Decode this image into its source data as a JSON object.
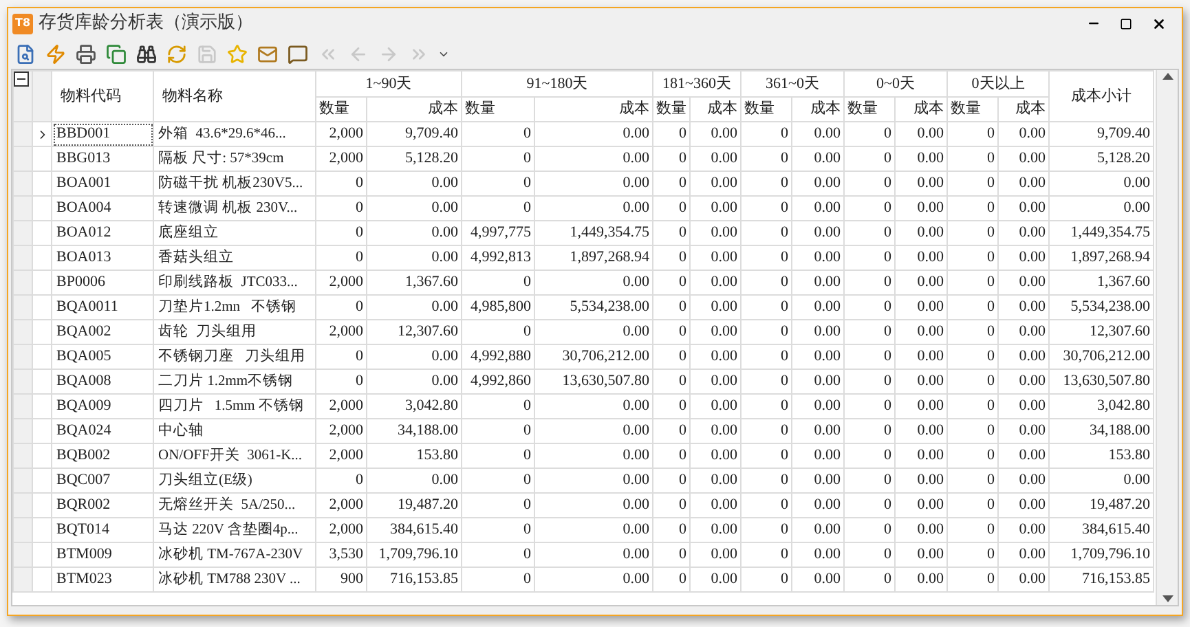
{
  "window": {
    "title": "存货库龄分析表（演示版）",
    "app_icon": "T8"
  },
  "toolbar": [
    {
      "kind": "preview",
      "disabled": false
    },
    {
      "kind": "flash",
      "disabled": false
    },
    {
      "kind": "print",
      "disabled": false
    },
    {
      "kind": "copy",
      "disabled": false
    },
    {
      "kind": "find",
      "disabled": false
    },
    {
      "kind": "refresh",
      "disabled": false
    },
    {
      "kind": "save",
      "disabled": true
    },
    {
      "kind": "star",
      "disabled": false
    },
    {
      "kind": "mail",
      "disabled": false
    },
    {
      "kind": "comment",
      "disabled": false
    },
    {
      "kind": "first",
      "disabled": true
    },
    {
      "kind": "prev",
      "disabled": true
    },
    {
      "kind": "next",
      "disabled": true
    },
    {
      "kind": "last",
      "disabled": true
    },
    {
      "kind": "more",
      "disabled": false
    }
  ],
  "table": {
    "columns": {
      "code": "物料代码",
      "name": "物料名称",
      "subtotal": "成本小计",
      "groups": [
        {
          "label": "1~90天",
          "qty": "数量",
          "cost": "成本"
        },
        {
          "label": "91~180天",
          "qty": "数量",
          "cost": "成本"
        },
        {
          "label": "181~360天",
          "qty": "数量",
          "cost": "成本"
        },
        {
          "label": "361~0天",
          "qty": "数量",
          "cost": "成本"
        },
        {
          "label": "0~0天",
          "qty": "数量",
          "cost": "成本"
        },
        {
          "label": "0天以上",
          "qty": "数量",
          "cost": "成本"
        }
      ]
    },
    "rows": [
      {
        "selected": true,
        "code": "BBD001",
        "name": "外箱  43.6*29.6*46...",
        "values": [
          "2,000",
          "9,709.40",
          "0",
          "0.00",
          "0",
          "0.00",
          "0",
          "0.00",
          "0",
          "0.00",
          "0",
          "0.00",
          "9,709.40"
        ]
      },
      {
        "selected": false,
        "code": "BBG013",
        "name": "隔板 尺寸: 57*39cm",
        "values": [
          "2,000",
          "5,128.20",
          "0",
          "0.00",
          "0",
          "0.00",
          "0",
          "0.00",
          "0",
          "0.00",
          "0",
          "0.00",
          "5,128.20"
        ]
      },
      {
        "selected": false,
        "code": "BOA001",
        "name": "防磁干扰 机板230V5...",
        "values": [
          "0",
          "0.00",
          "0",
          "0.00",
          "0",
          "0.00",
          "0",
          "0.00",
          "0",
          "0.00",
          "0",
          "0.00",
          "0.00"
        ]
      },
      {
        "selected": false,
        "code": "BOA004",
        "name": "转速微调 机板 230V...",
        "values": [
          "0",
          "0.00",
          "0",
          "0.00",
          "0",
          "0.00",
          "0",
          "0.00",
          "0",
          "0.00",
          "0",
          "0.00",
          "0.00"
        ]
      },
      {
        "selected": false,
        "code": "BOA012",
        "name": "底座组立",
        "values": [
          "0",
          "0.00",
          "4,997,775",
          "1,449,354.75",
          "0",
          "0.00",
          "0",
          "0.00",
          "0",
          "0.00",
          "0",
          "0.00",
          "1,449,354.75"
        ]
      },
      {
        "selected": false,
        "code": "BOA013",
        "name": "香菇头组立",
        "values": [
          "0",
          "0.00",
          "4,992,813",
          "1,897,268.94",
          "0",
          "0.00",
          "0",
          "0.00",
          "0",
          "0.00",
          "0",
          "0.00",
          "1,897,268.94"
        ]
      },
      {
        "selected": false,
        "code": "BP0006",
        "name": "印刷线路板  JTC033...",
        "values": [
          "2,000",
          "1,367.60",
          "0",
          "0.00",
          "0",
          "0.00",
          "0",
          "0.00",
          "0",
          "0.00",
          "0",
          "0.00",
          "1,367.60"
        ]
      },
      {
        "selected": false,
        "code": "BQA0011",
        "name": "刀垫片1.2mn   不锈钢",
        "values": [
          "0",
          "0.00",
          "4,985,800",
          "5,534,238.00",
          "0",
          "0.00",
          "0",
          "0.00",
          "0",
          "0.00",
          "0",
          "0.00",
          "5,534,238.00"
        ]
      },
      {
        "selected": false,
        "code": "BQA002",
        "name": "齿轮  刀头组用",
        "values": [
          "2,000",
          "12,307.60",
          "0",
          "0.00",
          "0",
          "0.00",
          "0",
          "0.00",
          "0",
          "0.00",
          "0",
          "0.00",
          "12,307.60"
        ]
      },
      {
        "selected": false,
        "code": "BQA005",
        "name": "不锈钢刀座   刀头组用",
        "values": [
          "0",
          "0.00",
          "4,992,880",
          "30,706,212.00",
          "0",
          "0.00",
          "0",
          "0.00",
          "0",
          "0.00",
          "0",
          "0.00",
          "30,706,212.00"
        ]
      },
      {
        "selected": false,
        "code": "BQA008",
        "name": "二刀片 1.2mm不锈钢",
        "values": [
          "0",
          "0.00",
          "4,992,860",
          "13,630,507.80",
          "0",
          "0.00",
          "0",
          "0.00",
          "0",
          "0.00",
          "0",
          "0.00",
          "13,630,507.80"
        ]
      },
      {
        "selected": false,
        "code": "BQA009",
        "name": "四刀片   1.5mm 不锈钢",
        "values": [
          "2,000",
          "3,042.80",
          "0",
          "0.00",
          "0",
          "0.00",
          "0",
          "0.00",
          "0",
          "0.00",
          "0",
          "0.00",
          "3,042.80"
        ]
      },
      {
        "selected": false,
        "code": "BQA024",
        "name": "中心轴",
        "values": [
          "2,000",
          "34,188.00",
          "0",
          "0.00",
          "0",
          "0.00",
          "0",
          "0.00",
          "0",
          "0.00",
          "0",
          "0.00",
          "34,188.00"
        ]
      },
      {
        "selected": false,
        "code": "BQB002",
        "name": "ON/OFF开关  3061-K...",
        "values": [
          "2,000",
          "153.80",
          "0",
          "0.00",
          "0",
          "0.00",
          "0",
          "0.00",
          "0",
          "0.00",
          "0",
          "0.00",
          "153.80"
        ]
      },
      {
        "selected": false,
        "code": "BQC007",
        "name": "刀头组立(E级)",
        "values": [
          "0",
          "0.00",
          "0",
          "0.00",
          "0",
          "0.00",
          "0",
          "0.00",
          "0",
          "0.00",
          "0",
          "0.00",
          "0.00"
        ]
      },
      {
        "selected": false,
        "code": "BQR002",
        "name": "无熔丝开关  5A/250...",
        "values": [
          "2,000",
          "19,487.20",
          "0",
          "0.00",
          "0",
          "0.00",
          "0",
          "0.00",
          "0",
          "0.00",
          "0",
          "0.00",
          "19,487.20"
        ]
      },
      {
        "selected": false,
        "code": "BQT014",
        "name": "马达 220V 含垫圈4p...",
        "values": [
          "2,000",
          "384,615.40",
          "0",
          "0.00",
          "0",
          "0.00",
          "0",
          "0.00",
          "0",
          "0.00",
          "0",
          "0.00",
          "384,615.40"
        ]
      },
      {
        "selected": false,
        "code": "BTM009",
        "name": "冰砂机 TM-767A-230V",
        "values": [
          "3,530",
          "1,709,796.10",
          "0",
          "0.00",
          "0",
          "0.00",
          "0",
          "0.00",
          "0",
          "0.00",
          "0",
          "0.00",
          "1,709,796.10"
        ]
      },
      {
        "selected": false,
        "code": "BTM023",
        "name": "冰砂机 TM788 230V ...",
        "values": [
          "900",
          "716,153.85",
          "0",
          "0.00",
          "0",
          "0.00",
          "0",
          "0.00",
          "0",
          "0.00",
          "0",
          "0.00",
          "716,153.85"
        ]
      }
    ]
  }
}
